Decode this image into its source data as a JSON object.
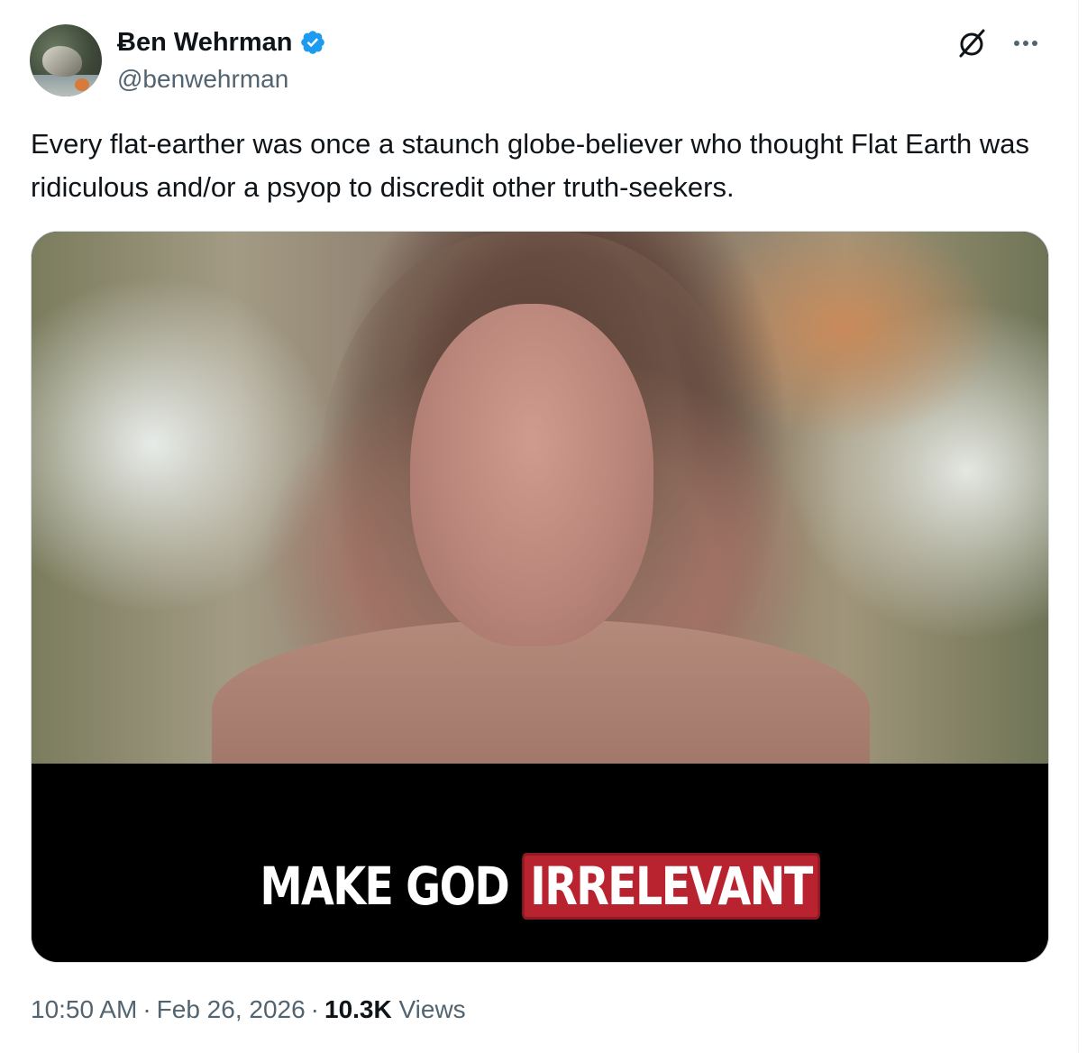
{
  "author": {
    "display_name": "Ƀen Wehrman",
    "handle": "@benwehrman",
    "verified": true,
    "verified_color": "#1d9bf0"
  },
  "tweet": {
    "text": "Every flat-earther was once a staunch globe-believer who thought Flat Earth was ridiculous and/or a psyop to discredit other truth-seekers."
  },
  "media": {
    "caption_part1": "MAKE GOD",
    "caption_part2": "IRRELEVANT",
    "caption_highlight_color": "#b8232f"
  },
  "meta": {
    "time": "10:50 AM",
    "separator": "·",
    "date": "Feb 26, 2026",
    "views_count": "10.3K",
    "views_label": "Views"
  },
  "icons": {
    "grok": "grok-icon",
    "more": "more-icon"
  }
}
